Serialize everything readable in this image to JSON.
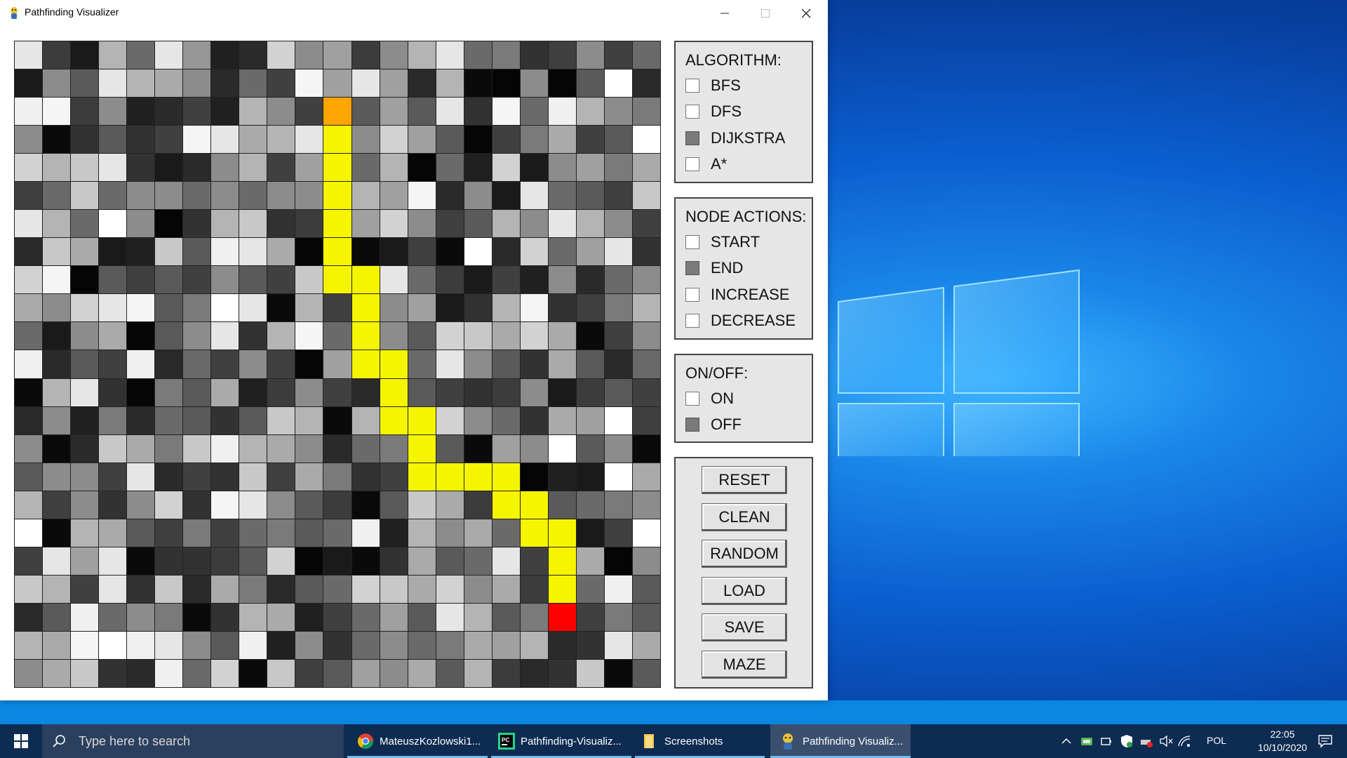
{
  "window": {
    "title": "Pathfinding Visualizer"
  },
  "grid": {
    "rows": 23,
    "cols": 23,
    "path_color": "#f5f500",
    "start_color": "#ffa500",
    "end_color": "#ff0000",
    "start": [
      2,
      11
    ],
    "end": [
      20,
      19
    ],
    "path": [
      [
        3,
        11
      ],
      [
        4,
        11
      ],
      [
        5,
        11
      ],
      [
        6,
        11
      ],
      [
        7,
        11
      ],
      [
        8,
        11
      ],
      [
        8,
        12
      ],
      [
        9,
        12
      ],
      [
        10,
        12
      ],
      [
        11,
        12
      ],
      [
        11,
        13
      ],
      [
        12,
        13
      ],
      [
        13,
        13
      ],
      [
        13,
        14
      ],
      [
        14,
        14
      ],
      [
        15,
        14
      ],
      [
        15,
        15
      ],
      [
        15,
        16
      ],
      [
        15,
        17
      ],
      [
        16,
        17
      ],
      [
        16,
        18
      ],
      [
        17,
        18
      ],
      [
        17,
        19
      ],
      [
        18,
        19
      ],
      [
        19,
        19
      ]
    ],
    "shades": [
      [
        "#e6e6e6",
        "#3c3c3c",
        "#1a1a1a",
        "#b4b4b4",
        "#6a6a6a",
        "#e6e6e6",
        "#969696",
        "#202020",
        "#2a2a2a",
        "#d2d2d2",
        "#8c8c8c",
        "#a0a0a0",
        "#3c3c3c",
        "#8c8c8c",
        "#b4b4b4",
        "#e6e6e6",
        "#6a6a6a",
        "#7a7a7a",
        "#323232",
        "#404040",
        "#8c8c8c",
        "#404040",
        "#6a6a6a"
      ],
      [
        "#1a1a1a",
        "#8c8c8c",
        "#5a5a5a",
        "#e6e6e6",
        "#b4b4b4",
        "#aaaaaa",
        "#8c8c8c",
        "#2a2a2a",
        "#6a6a6a",
        "#404040",
        "#f5f5f5",
        "#a0a0a0",
        "#e6e6e6",
        "#a0a0a0",
        "#2a2a2a",
        "#b4b4b4",
        "#0a0a0a",
        "#050505",
        "#8c8c8c",
        "#050505",
        "#5a5a5a",
        "#ffffff",
        "#2a2a2a"
      ],
      [
        "#f0f0f0",
        "#f5f5f5",
        "#3c3c3c",
        "#8c8c8c",
        "#202020",
        "#2a2a2a",
        "#404040",
        "#202020",
        "#b4b4b4",
        "#8c8c8c",
        "#404040",
        "#ffa500",
        "#5a5a5a",
        "#a0a0a0",
        "#5a5a5a",
        "#e6e6e6",
        "#323232",
        "#f5f5f5",
        "#6a6a6a",
        "#f0f0f0",
        "#b4b4b4",
        "#8c8c8c",
        "#7a7a7a"
      ],
      [
        "#8c8c8c",
        "#0a0a0a",
        "#323232",
        "#5a5a5a",
        "#323232",
        "#404040",
        "#f5f5f5",
        "#e6e6e6",
        "#aaaaaa",
        "#b4b4b4",
        "#e6e6e6",
        "#f5f500",
        "#8c8c8c",
        "#d2d2d2",
        "#a0a0a0",
        "#5a5a5a",
        "#050505",
        "#404040",
        "#7a7a7a",
        "#aaaaaa",
        "#404040",
        "#5a5a5a",
        "#ffffff"
      ],
      [
        "#d2d2d2",
        "#b4b4b4",
        "#c8c8c8",
        "#e6e6e6",
        "#323232",
        "#1a1a1a",
        "#2a2a2a",
        "#8c8c8c",
        "#b4b4b4",
        "#404040",
        "#a0a0a0",
        "#f5f500",
        "#6a6a6a",
        "#b4b4b4",
        "#050505",
        "#6a6a6a",
        "#202020",
        "#d2d2d2",
        "#1a1a1a",
        "#8c8c8c",
        "#a0a0a0",
        "#7a7a7a",
        "#aaaaaa"
      ],
      [
        "#404040",
        "#6a6a6a",
        "#c8c8c8",
        "#6a6a6a",
        "#8c8c8c",
        "#8c8c8c",
        "#6a6a6a",
        "#8c8c8c",
        "#6a6a6a",
        "#8c8c8c",
        "#8c8c8c",
        "#f5f500",
        "#b4b4b4",
        "#a0a0a0",
        "#f5f5f5",
        "#2a2a2a",
        "#8c8c8c",
        "#1a1a1a",
        "#e6e6e6",
        "#6a6a6a",
        "#5a5a5a",
        "#404040",
        "#c8c8c8"
      ],
      [
        "#e6e6e6",
        "#b4b4b4",
        "#6a6a6a",
        "#ffffff",
        "#8c8c8c",
        "#050505",
        "#323232",
        "#b4b4b4",
        "#c8c8c8",
        "#323232",
        "#3c3c3c",
        "#f5f500",
        "#a0a0a0",
        "#d2d2d2",
        "#8c8c8c",
        "#404040",
        "#5a5a5a",
        "#b4b4b4",
        "#8c8c8c",
        "#e6e6e6",
        "#b4b4b4",
        "#8c8c8c",
        "#404040"
      ],
      [
        "#2a2a2a",
        "#c8c8c8",
        "#aaaaaa",
        "#1a1a1a",
        "#202020",
        "#c8c8c8",
        "#5a5a5a",
        "#f0f0f0",
        "#e6e6e6",
        "#aaaaaa",
        "#050505",
        "#f5f500",
        "#0a0a0a",
        "#1a1a1a",
        "#404040",
        "#0a0a0a",
        "#ffffff",
        "#2a2a2a",
        "#d2d2d2",
        "#6a6a6a",
        "#a0a0a0",
        "#e6e6e6",
        "#323232"
      ],
      [
        "#d2d2d2",
        "#f5f5f5",
        "#050505",
        "#5a5a5a",
        "#404040",
        "#5a5a5a",
        "#404040",
        "#8c8c8c",
        "#5a5a5a",
        "#404040",
        "#c8c8c8",
        "#f5f500",
        "#f5f500",
        "#e6e6e6",
        "#6a6a6a",
        "#3c3c3c",
        "#1a1a1a",
        "#404040",
        "#202020",
        "#8c8c8c",
        "#2a2a2a",
        "#6a6a6a",
        "#8c8c8c"
      ],
      [
        "#aaaaaa",
        "#8c8c8c",
        "#d2d2d2",
        "#e6e6e6",
        "#f5f5f5",
        "#5a5a5a",
        "#7a7a7a",
        "#ffffff",
        "#e6e6e6",
        "#0a0a0a",
        "#b4b4b4",
        "#404040",
        "#f5f500",
        "#8c8c8c",
        "#a0a0a0",
        "#1a1a1a",
        "#323232",
        "#b4b4b4",
        "#f5f5f5",
        "#323232",
        "#404040",
        "#7a7a7a",
        "#b4b4b4"
      ],
      [
        "#6a6a6a",
        "#1a1a1a",
        "#8c8c8c",
        "#aaaaaa",
        "#050505",
        "#5a5a5a",
        "#8c8c8c",
        "#e6e6e6",
        "#323232",
        "#b4b4b4",
        "#f5f5f5",
        "#6a6a6a",
        "#f5f500",
        "#8c8c8c",
        "#5a5a5a",
        "#d2d2d2",
        "#c8c8c8",
        "#aaaaaa",
        "#d2d2d2",
        "#aaaaaa",
        "#0a0a0a",
        "#404040",
        "#8c8c8c"
      ],
      [
        "#f0f0f0",
        "#2a2a2a",
        "#5a5a5a",
        "#404040",
        "#f0f0f0",
        "#2a2a2a",
        "#6a6a6a",
        "#404040",
        "#8c8c8c",
        "#404040",
        "#050505",
        "#a0a0a0",
        "#f5f500",
        "#f5f500",
        "#6a6a6a",
        "#e6e6e6",
        "#8c8c8c",
        "#5a5a5a",
        "#323232",
        "#aaaaaa",
        "#5a5a5a",
        "#2a2a2a",
        "#6a6a6a"
      ],
      [
        "#0a0a0a",
        "#b4b4b4",
        "#e6e6e6",
        "#323232",
        "#050505",
        "#7a7a7a",
        "#5a5a5a",
        "#aaaaaa",
        "#202020",
        "#3c3c3c",
        "#8c8c8c",
        "#404040",
        "#2a2a2a",
        "#f5f500",
        "#5a5a5a",
        "#404040",
        "#323232",
        "#3c3c3c",
        "#8c8c8c",
        "#1a1a1a",
        "#3c3c3c",
        "#5a5a5a",
        "#404040"
      ],
      [
        "#2a2a2a",
        "#8c8c8c",
        "#202020",
        "#7a7a7a",
        "#2a2a2a",
        "#6a6a6a",
        "#5a5a5a",
        "#323232",
        "#5a5a5a",
        "#c8c8c8",
        "#b4b4b4",
        "#0a0a0a",
        "#b4b4b4",
        "#f5f500",
        "#f5f500",
        "#d2d2d2",
        "#8c8c8c",
        "#6a6a6a",
        "#323232",
        "#aaaaaa",
        "#a0a0a0",
        "#ffffff",
        "#404040"
      ],
      [
        "#8c8c8c",
        "#0a0a0a",
        "#2a2a2a",
        "#c8c8c8",
        "#aaaaaa",
        "#7a7a7a",
        "#c8c8c8",
        "#f0f0f0",
        "#b4b4b4",
        "#aaaaaa",
        "#8c8c8c",
        "#2a2a2a",
        "#6a6a6a",
        "#7a7a7a",
        "#f5f500",
        "#5a5a5a",
        "#0a0a0a",
        "#a0a0a0",
        "#8c8c8c",
        "#ffffff",
        "#5a5a5a",
        "#8c8c8c",
        "#0a0a0a"
      ],
      [
        "#5a5a5a",
        "#8c8c8c",
        "#8c8c8c",
        "#404040",
        "#e6e6e6",
        "#2a2a2a",
        "#404040",
        "#323232",
        "#c8c8c8",
        "#404040",
        "#aaaaaa",
        "#7a7a7a",
        "#323232",
        "#404040",
        "#f5f500",
        "#f5f500",
        "#f5f500",
        "#f5f500",
        "#050505",
        "#202020",
        "#1a1a1a",
        "#ffffff",
        "#aaaaaa"
      ],
      [
        "#b4b4b4",
        "#404040",
        "#8c8c8c",
        "#323232",
        "#8c8c8c",
        "#d2d2d2",
        "#323232",
        "#f5f5f5",
        "#e6e6e6",
        "#8c8c8c",
        "#5a5a5a",
        "#3c3c3c",
        "#0a0a0a",
        "#5a5a5a",
        "#c8c8c8",
        "#aaaaaa",
        "#3c3c3c",
        "#f5f500",
        "#f5f500",
        "#5a5a5a",
        "#6a6a6a",
        "#7a7a7a",
        "#8c8c8c"
      ],
      [
        "#ffffff",
        "#0a0a0a",
        "#b4b4b4",
        "#aaaaaa",
        "#5a5a5a",
        "#404040",
        "#7a7a7a",
        "#404040",
        "#6a6a6a",
        "#7a7a7a",
        "#5a5a5a",
        "#6a6a6a",
        "#f0f0f0",
        "#202020",
        "#b4b4b4",
        "#8c8c8c",
        "#aaaaaa",
        "#6a6a6a",
        "#f5f500",
        "#f5f500",
        "#1a1a1a",
        "#404040",
        "#ffffff"
      ],
      [
        "#404040",
        "#e6e6e6",
        "#a0a0a0",
        "#e6e6e6",
        "#0a0a0a",
        "#323232",
        "#323232",
        "#3c3c3c",
        "#5a5a5a",
        "#d2d2d2",
        "#050505",
        "#1a1a1a",
        "#0a0a0a",
        "#323232",
        "#aaaaaa",
        "#5a5a5a",
        "#6a6a6a",
        "#e6e6e6",
        "#404040",
        "#f5f500",
        "#aaaaaa",
        "#050505",
        "#8c8c8c"
      ],
      [
        "#c8c8c8",
        "#b4b4b4",
        "#404040",
        "#e6e6e6",
        "#323232",
        "#c8c8c8",
        "#2a2a2a",
        "#aaaaaa",
        "#7a7a7a",
        "#2a2a2a",
        "#5a5a5a",
        "#6a6a6a",
        "#d2d2d2",
        "#c8c8c8",
        "#aaaaaa",
        "#d2d2d2",
        "#8c8c8c",
        "#aaaaaa",
        "#3c3c3c",
        "#f5f500",
        "#6a6a6a",
        "#f0f0f0",
        "#5a5a5a"
      ],
      [
        "#2a2a2a",
        "#5a5a5a",
        "#f0f0f0",
        "#6a6a6a",
        "#8c8c8c",
        "#7a7a7a",
        "#0a0a0a",
        "#323232",
        "#b4b4b4",
        "#aaaaaa",
        "#202020",
        "#404040",
        "#6a6a6a",
        "#a0a0a0",
        "#5a5a5a",
        "#e6e6e6",
        "#b4b4b4",
        "#5a5a5a",
        "#7a7a7a",
        "#ff0000",
        "#404040",
        "#7a7a7a",
        "#5a5a5a"
      ],
      [
        "#b4b4b4",
        "#aaaaaa",
        "#f5f5f5",
        "#ffffff",
        "#f0f0f0",
        "#e6e6e6",
        "#8c8c8c",
        "#5a5a5a",
        "#f0f0f0",
        "#202020",
        "#8c8c8c",
        "#323232",
        "#6a6a6a",
        "#8c8c8c",
        "#6a6a6a",
        "#7a7a7a",
        "#aaaaaa",
        "#a0a0a0",
        "#b4b4b4",
        "#2a2a2a",
        "#323232",
        "#e6e6e6",
        "#aaaaaa"
      ],
      [
        "#8c8c8c",
        "#aaaaaa",
        "#c8c8c8",
        "#323232",
        "#2a2a2a",
        "#f0f0f0",
        "#6a6a6a",
        "#d2d2d2",
        "#0a0a0a",
        "#c8c8c8",
        "#404040",
        "#5a5a5a",
        "#a0a0a0",
        "#8c8c8c",
        "#aaaaaa",
        "#5a5a5a",
        "#b4b4b4",
        "#3c3c3c",
        "#2a2a2a",
        "#323232",
        "#c8c8c8",
        "#0a0a0a",
        "#5a5a5a"
      ]
    ]
  },
  "algorithm_panel": {
    "title": "ALGORITHM:",
    "options": [
      {
        "label": "BFS",
        "checked": false
      },
      {
        "label": "DFS",
        "checked": false
      },
      {
        "label": "DIJKSTRA",
        "checked": true
      },
      {
        "label": "A*",
        "checked": false
      }
    ]
  },
  "node_actions_panel": {
    "title": "NODE ACTIONS:",
    "options": [
      {
        "label": "START",
        "checked": false
      },
      {
        "label": "END",
        "checked": true
      },
      {
        "label": "INCREASE",
        "checked": false
      },
      {
        "label": "DECREASE",
        "checked": false
      }
    ]
  },
  "onoff_panel": {
    "title": "ON/OFF:",
    "options": [
      {
        "label": "ON",
        "checked": false
      },
      {
        "label": "OFF",
        "checked": true
      }
    ]
  },
  "buttons": [
    "RESET",
    "CLEAN",
    "RANDOM",
    "LOAD",
    "SAVE",
    "MAZE"
  ],
  "taskbar": {
    "search_placeholder": "Type here to search",
    "items": [
      {
        "label": "MateuszKozlowski1...",
        "icon": "chrome-icon"
      },
      {
        "label": "Pathfinding-Visualiz...",
        "icon": "pycharm-icon"
      },
      {
        "label": "Screenshots",
        "icon": "folder-icon"
      },
      {
        "label": "Pathfinding Visualiz...",
        "icon": "pygame-icon"
      }
    ],
    "language": "POL",
    "time": "22:05",
    "date": "10/10/2020"
  }
}
